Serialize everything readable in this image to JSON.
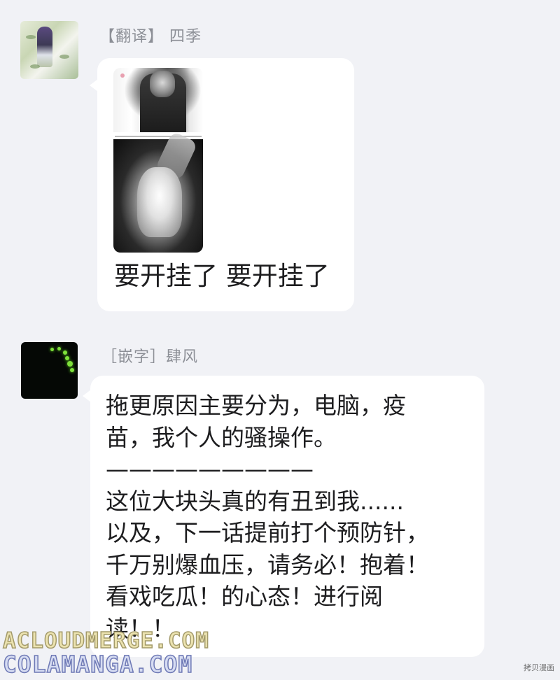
{
  "messages": [
    {
      "sender": "【翻译】 四季",
      "text": "要开挂了 要开挂了",
      "has_image": true
    },
    {
      "sender": "［嵌字］肆风",
      "lines": [
        "拖更原因主要分为，电脑，疫",
        "苗，我个人的骚操作。",
        "—————————",
        "这位大块头真的有丑到我......",
        "以及，下一话提前打个预防针，",
        "千万别爆血压，请务必！抱着！",
        "看戏吃瓜！的心态！进行阅",
        "读！！"
      ]
    }
  ],
  "watermarks": {
    "line1": "ACLOUDMERGE.COM",
    "line2": "COLAMANGA.COM",
    "corner": "拷贝漫画"
  },
  "colors": {
    "background": "#f1f2f6",
    "bubble": "#ffffff",
    "sender_text": "#8c8f96",
    "message_text": "#1d1d1f"
  }
}
